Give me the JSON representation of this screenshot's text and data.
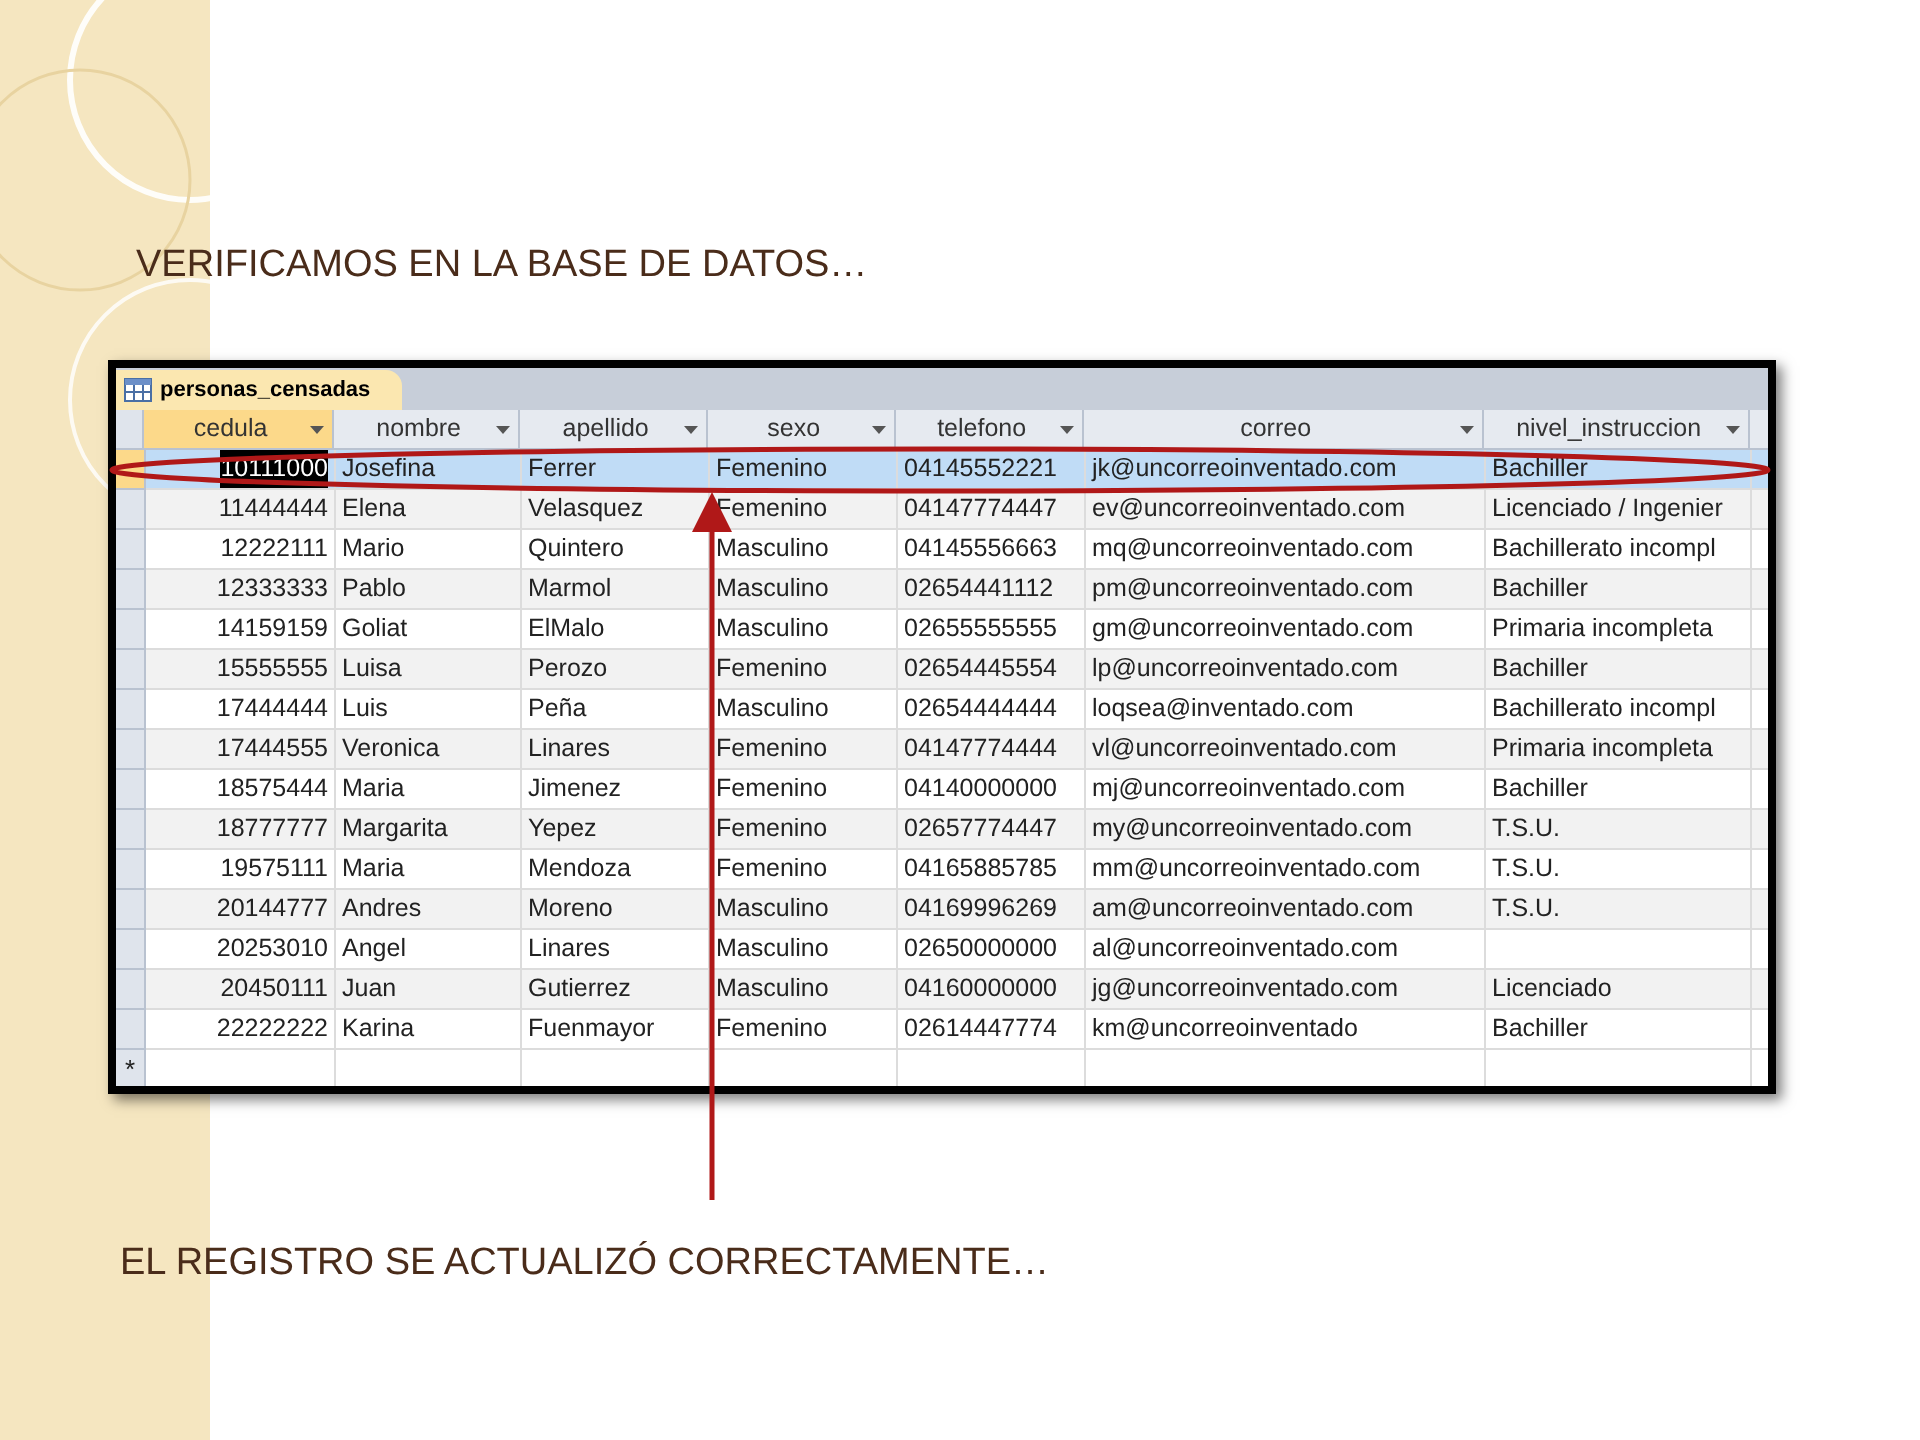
{
  "slide": {
    "heading": "VERIFICAMOS EN LA BASE DE DATOS…",
    "caption": "EL REGISTRO SE ACTUALIZÓ CORRECTAMENTE…"
  },
  "table": {
    "tab": {
      "label": "personas_censadas",
      "selected": true
    },
    "columns": [
      {
        "label": "cedula",
        "kind": "number",
        "selected": true
      },
      {
        "label": "nombre",
        "kind": "text",
        "selected": false
      },
      {
        "label": "apellido",
        "kind": "text",
        "selected": false
      },
      {
        "label": "sexo",
        "kind": "text",
        "selected": false
      },
      {
        "label": "telefono",
        "kind": "text",
        "selected": false
      },
      {
        "label": "correo",
        "kind": "text",
        "selected": false
      },
      {
        "label": "nivel_instruccion",
        "kind": "text",
        "selected": false
      }
    ],
    "rows": [
      {
        "selected": true,
        "cells": [
          "10111000",
          "Josefina",
          "Ferrer",
          "Femenino",
          "04145552221",
          "jk@uncorreoinventado.com",
          "Bachiller"
        ]
      },
      {
        "selected": false,
        "cells": [
          "11444444",
          "Elena",
          "Velasquez",
          "Femenino",
          "04147774447",
          "ev@uncorreoinventado.com",
          "Licenciado / Ingenier"
        ]
      },
      {
        "selected": false,
        "cells": [
          "12222111",
          "Mario",
          "Quintero",
          "Masculino",
          "04145556663",
          "mq@uncorreoinventado.com",
          "Bachillerato incompl"
        ]
      },
      {
        "selected": false,
        "cells": [
          "12333333",
          "Pablo",
          "Marmol",
          "Masculino",
          "02654441112",
          "pm@uncorreoinventado.com",
          "Bachiller"
        ]
      },
      {
        "selected": false,
        "cells": [
          "14159159",
          "Goliat",
          "ElMalo",
          "Masculino",
          "02655555555",
          "gm@uncorreoinventado.com",
          "Primaria incompleta"
        ]
      },
      {
        "selected": false,
        "cells": [
          "15555555",
          "Luisa",
          "Perozo",
          "Femenino",
          "02654445554",
          "lp@uncorreoinventado.com",
          "Bachiller"
        ]
      },
      {
        "selected": false,
        "cells": [
          "17444444",
          "Luis",
          "Peña",
          "Masculino",
          "02654444444",
          "loqsea@inventado.com",
          "Bachillerato incompl"
        ]
      },
      {
        "selected": false,
        "cells": [
          "17444555",
          "Veronica",
          "Linares",
          "Femenino",
          "04147774444",
          "vl@uncorreoinventado.com",
          "Primaria incompleta"
        ]
      },
      {
        "selected": false,
        "cells": [
          "18575444",
          "Maria",
          "Jimenez",
          "Femenino",
          "04140000000",
          "mj@uncorreoinventado.com",
          "Bachiller"
        ]
      },
      {
        "selected": false,
        "cells": [
          "18777777",
          "Margarita",
          "Yepez",
          "Femenino",
          "02657774447",
          "my@uncorreoinventado.com",
          "T.S.U."
        ]
      },
      {
        "selected": false,
        "cells": [
          "19575111",
          "Maria",
          "Mendoza",
          "Femenino",
          "04165885785",
          "mm@uncorreoinventado.com",
          "T.S.U."
        ]
      },
      {
        "selected": false,
        "cells": [
          "20144777",
          "Andres",
          "Moreno",
          "Masculino",
          "04169996269",
          "am@uncorreoinventado.com",
          "T.S.U."
        ]
      },
      {
        "selected": false,
        "cells": [
          "20253010",
          "Angel",
          "Linares",
          "Masculino",
          "02650000000",
          "al@uncorreoinventado.com",
          ""
        ]
      },
      {
        "selected": false,
        "cells": [
          "20450111",
          "Juan",
          "Gutierrez",
          "Masculino",
          "04160000000",
          "jg@uncorreoinventado.com",
          "Licenciado"
        ]
      },
      {
        "selected": false,
        "cells": [
          "22222222",
          "Karina",
          "Fuenmayor",
          "Femenino",
          "02614447774",
          "km@uncorreoinventado",
          "Bachiller"
        ]
      }
    ],
    "new_row_marker": "*"
  }
}
